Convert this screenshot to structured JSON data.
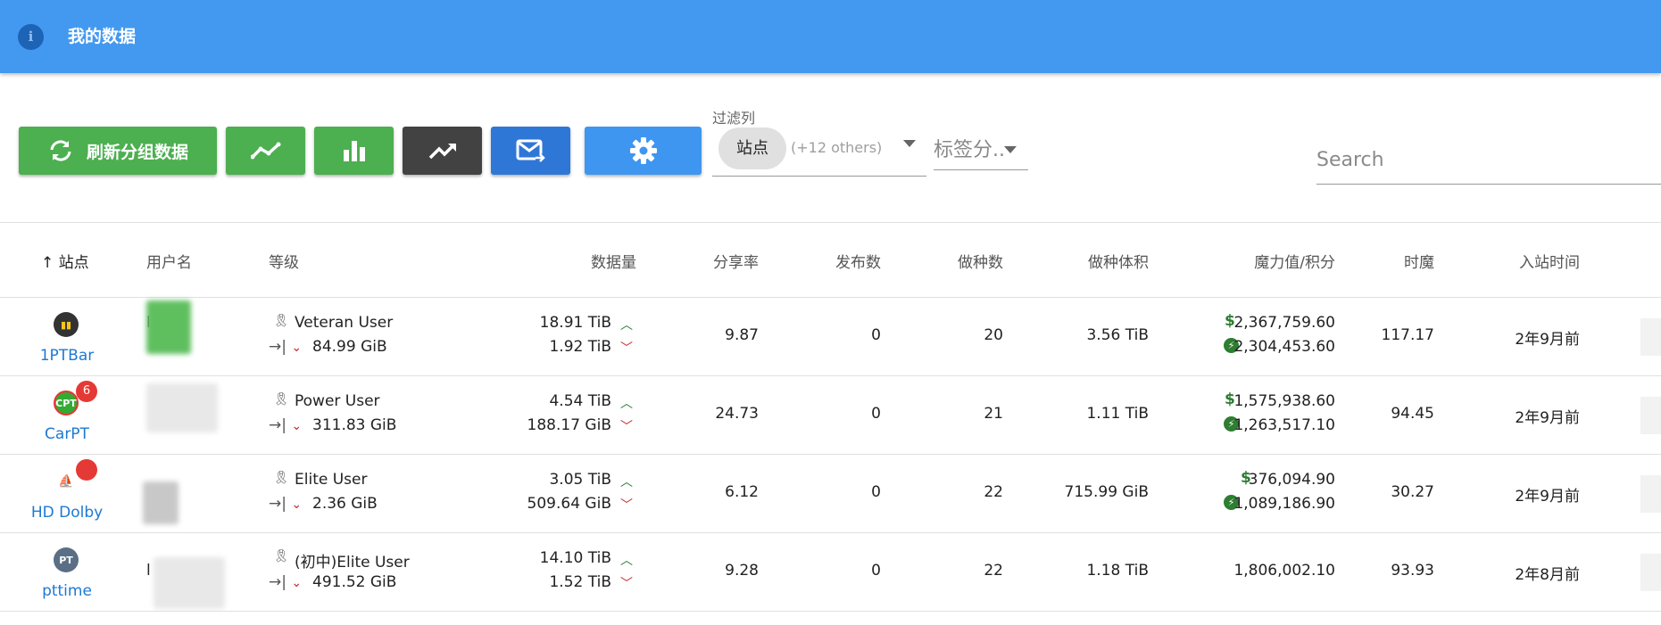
{
  "header": {
    "title": "我的数据",
    "info_icon": "i"
  },
  "toolbar": {
    "refresh_label": "刷新分组数据",
    "filter_caption": "过滤列",
    "filter_chip": "站点",
    "filter_more": "(+12 others)",
    "tag_placeholder": "标签分..",
    "search_placeholder": "Search"
  },
  "table": {
    "headers": {
      "site": "站点",
      "sort_arrow": "↑",
      "username": "用户名",
      "level": "等级",
      "data": "数据量",
      "ratio": "分享率",
      "published": "发布数",
      "seeding": "做种数",
      "seed_size": "做种体积",
      "bonus": "魔力值/积分",
      "hourly": "时魔",
      "joined": "入站时间"
    },
    "rows": [
      {
        "site": "1PTBar",
        "badge": "",
        "level": "Veteran User",
        "next": "84.99 GiB",
        "upload": "18.91 TiB",
        "download": "1.92 TiB",
        "ratio": "9.87",
        "published": "0",
        "seeding": "20",
        "seed_size": "3.56 TiB",
        "bonus": "2,367,759.60",
        "points": "2,304,453.60",
        "hourly": "117.17",
        "joined": "2年9月前",
        "username": "l"
      },
      {
        "site": "CarPT",
        "badge": "6",
        "level": "Power User",
        "next": "311.83 GiB",
        "upload": "4.54 TiB",
        "download": "188.17 GiB",
        "ratio": "24.73",
        "published": "0",
        "seeding": "21",
        "seed_size": "1.11 TiB",
        "bonus": "1,575,938.60",
        "points": "1,263,517.10",
        "hourly": "94.45",
        "joined": "2年9月前",
        "username": ""
      },
      {
        "site": "HD Dolby",
        "badge": "",
        "level": "Elite User",
        "next": "2.36 GiB",
        "upload": "3.05 TiB",
        "download": "509.64 GiB",
        "ratio": "6.12",
        "published": "0",
        "seeding": "22",
        "seed_size": "715.99 GiB",
        "bonus": "376,094.90",
        "points": "1,089,186.90",
        "hourly": "30.27",
        "joined": "2年9月前",
        "username": ""
      },
      {
        "site": "pttime",
        "badge": "",
        "level": "(初中)Elite User",
        "next": "491.52 GiB",
        "upload": "14.10 TiB",
        "download": "1.52 TiB",
        "ratio": "9.28",
        "published": "0",
        "seeding": "22",
        "seed_size": "1.18 TiB",
        "bonus": "",
        "points": "1,806,002.10",
        "hourly": "93.93",
        "joined": "2年8月前",
        "username": "l"
      }
    ]
  },
  "colors": {
    "appbar": "#4299ef",
    "green": "#4caf50",
    "dark": "#424242",
    "blue": "#2f77d6",
    "link": "#1e79d3"
  },
  "icons": {
    "refresh": "refresh-icon",
    "line_chart": "line-chart-icon",
    "bar_chart": "bar-chart-icon",
    "trend": "trending-up-icon",
    "mail": "mail-forward-icon",
    "settings": "gear-icon"
  }
}
